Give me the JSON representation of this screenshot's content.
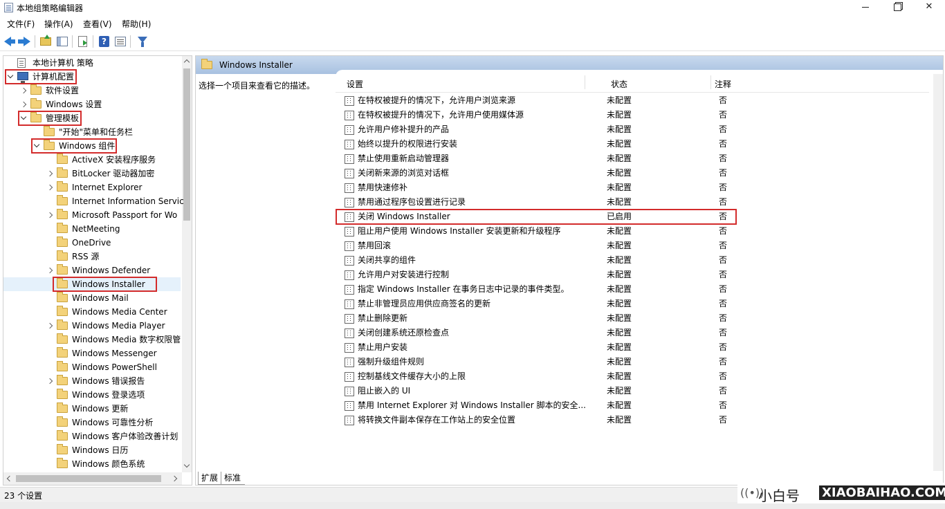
{
  "window": {
    "title": "本地组策略编辑器"
  },
  "menu": [
    "文件(F)",
    "操作(A)",
    "查看(V)",
    "帮助(H)"
  ],
  "toolbar": {
    "icons": [
      "back-arrow-icon",
      "forward-arrow-icon",
      "folder-up-icon",
      "show-hide-tree-icon",
      "export-icon",
      "help-icon",
      "view-icon",
      "filter-icon"
    ]
  },
  "tree": {
    "items": [
      {
        "label": "本地计算机 策略",
        "level": 0,
        "icon": "policy-doc-icon",
        "chevron": "none"
      },
      {
        "label": "计算机配置",
        "level": 0,
        "icon": "computer-icon",
        "chevron": "down",
        "highlighted": true
      },
      {
        "label": "软件设置",
        "level": 1,
        "icon": "folder-icon",
        "chevron": "right"
      },
      {
        "label": "Windows 设置",
        "level": 1,
        "icon": "folder-icon",
        "chevron": "right"
      },
      {
        "label": "管理模板",
        "level": 1,
        "icon": "folder-icon",
        "chevron": "down",
        "highlighted": true
      },
      {
        "label": "\"开始\"菜单和任务栏",
        "level": 2,
        "icon": "folder-icon",
        "chevron": "none"
      },
      {
        "label": "Windows 组件",
        "level": 2,
        "icon": "folder-icon",
        "chevron": "down",
        "highlighted": true
      },
      {
        "label": "ActiveX 安装程序服务",
        "level": 3,
        "icon": "folder-icon",
        "chevron": "none"
      },
      {
        "label": "BitLocker 驱动器加密",
        "level": 3,
        "icon": "folder-icon",
        "chevron": "right"
      },
      {
        "label": "Internet Explorer",
        "level": 3,
        "icon": "folder-icon",
        "chevron": "right"
      },
      {
        "label": "Internet Information Servic",
        "level": 3,
        "icon": "folder-icon",
        "chevron": "none"
      },
      {
        "label": "Microsoft Passport for Wo",
        "level": 3,
        "icon": "folder-icon",
        "chevron": "right"
      },
      {
        "label": "NetMeeting",
        "level": 3,
        "icon": "folder-icon",
        "chevron": "none"
      },
      {
        "label": "OneDrive",
        "level": 3,
        "icon": "folder-icon",
        "chevron": "none"
      },
      {
        "label": "RSS 源",
        "level": 3,
        "icon": "folder-icon",
        "chevron": "none"
      },
      {
        "label": "Windows Defender",
        "level": 3,
        "icon": "folder-icon",
        "chevron": "right"
      },
      {
        "label": "Windows Installer",
        "level": 3,
        "icon": "folder-icon",
        "chevron": "none",
        "highlighted": true,
        "selected": true
      },
      {
        "label": "Windows Mail",
        "level": 3,
        "icon": "folder-icon",
        "chevron": "none"
      },
      {
        "label": "Windows Media Center",
        "level": 3,
        "icon": "folder-icon",
        "chevron": "none"
      },
      {
        "label": "Windows Media Player",
        "level": 3,
        "icon": "folder-icon",
        "chevron": "right"
      },
      {
        "label": "Windows Media 数字权限管",
        "level": 3,
        "icon": "folder-icon",
        "chevron": "none"
      },
      {
        "label": "Windows Messenger",
        "level": 3,
        "icon": "folder-icon",
        "chevron": "none"
      },
      {
        "label": "Windows PowerShell",
        "level": 3,
        "icon": "folder-icon",
        "chevron": "none"
      },
      {
        "label": "Windows 错误报告",
        "level": 3,
        "icon": "folder-icon",
        "chevron": "right"
      },
      {
        "label": "Windows 登录选项",
        "level": 3,
        "icon": "folder-icon",
        "chevron": "none"
      },
      {
        "label": "Windows 更新",
        "level": 3,
        "icon": "folder-icon",
        "chevron": "none"
      },
      {
        "label": "Windows 可靠性分析",
        "level": 3,
        "icon": "folder-icon",
        "chevron": "none"
      },
      {
        "label": "Windows 客户体验改善计划",
        "level": 3,
        "icon": "folder-icon",
        "chevron": "none"
      },
      {
        "label": "Windows 日历",
        "level": 3,
        "icon": "folder-icon",
        "chevron": "none"
      },
      {
        "label": "Windows 颜色系统",
        "level": 3,
        "icon": "folder-icon",
        "chevron": "none"
      }
    ]
  },
  "right": {
    "header_title": "Windows Installer",
    "description": "选择一个项目来查看它的描述。",
    "columns": {
      "setting": "设置",
      "state": "状态",
      "note": "注释"
    },
    "rows": [
      {
        "setting": "在特权被提升的情况下，允许用户浏览来源",
        "state": "未配置",
        "note": "否"
      },
      {
        "setting": "在特权被提升的情况下，允许用户使用媒体源",
        "state": "未配置",
        "note": "否"
      },
      {
        "setting": "允许用户修补提升的产品",
        "state": "未配置",
        "note": "否"
      },
      {
        "setting": "始终以提升的权限进行安装",
        "state": "未配置",
        "note": "否"
      },
      {
        "setting": "禁止使用重新启动管理器",
        "state": "未配置",
        "note": "否"
      },
      {
        "setting": "关闭新来源的浏览对话框",
        "state": "未配置",
        "note": "否"
      },
      {
        "setting": "禁用快速修补",
        "state": "未配置",
        "note": "否"
      },
      {
        "setting": "禁用通过程序包设置进行记录",
        "state": "未配置",
        "note": "否"
      },
      {
        "setting": "关闭 Windows Installer",
        "state": "已启用",
        "note": "否",
        "highlighted": true
      },
      {
        "setting": "阻止用户使用 Windows Installer 安装更新和升级程序",
        "state": "未配置",
        "note": "否"
      },
      {
        "setting": "禁用回滚",
        "state": "未配置",
        "note": "否"
      },
      {
        "setting": "关闭共享的组件",
        "state": "未配置",
        "note": "否"
      },
      {
        "setting": "允许用户对安装进行控制",
        "state": "未配置",
        "note": "否"
      },
      {
        "setting": "指定 Windows Installer 在事务日志中记录的事件类型。",
        "state": "未配置",
        "note": "否"
      },
      {
        "setting": "禁止非管理员应用供应商签名的更新",
        "state": "未配置",
        "note": "否"
      },
      {
        "setting": "禁止删除更新",
        "state": "未配置",
        "note": "否"
      },
      {
        "setting": "关闭创建系统还原检查点",
        "state": "未配置",
        "note": "否"
      },
      {
        "setting": "禁止用户安装",
        "state": "未配置",
        "note": "否"
      },
      {
        "setting": "强制升级组件规则",
        "state": "未配置",
        "note": "否"
      },
      {
        "setting": "控制基线文件缓存大小的上限",
        "state": "未配置",
        "note": "否"
      },
      {
        "setting": "阻止嵌入的 UI",
        "state": "未配置",
        "note": "否"
      },
      {
        "setting": "禁用 Internet Explorer 对 Windows Installer 脚本的安全...",
        "state": "未配置",
        "note": "否"
      },
      {
        "setting": "将转换文件副本保存在工作站上的安全位置",
        "state": "未配置",
        "note": "否"
      }
    ]
  },
  "tabs": [
    "扩展",
    "标准"
  ],
  "status": {
    "text": "23 个设置"
  },
  "watermark": {
    "brand": "小白号",
    "domain": "XIAOBAIHAO.COM"
  },
  "colors": {
    "highlight_red": "#d32b2b",
    "header_blue": "#a8c1e0",
    "selection": "#e5f1fb"
  }
}
